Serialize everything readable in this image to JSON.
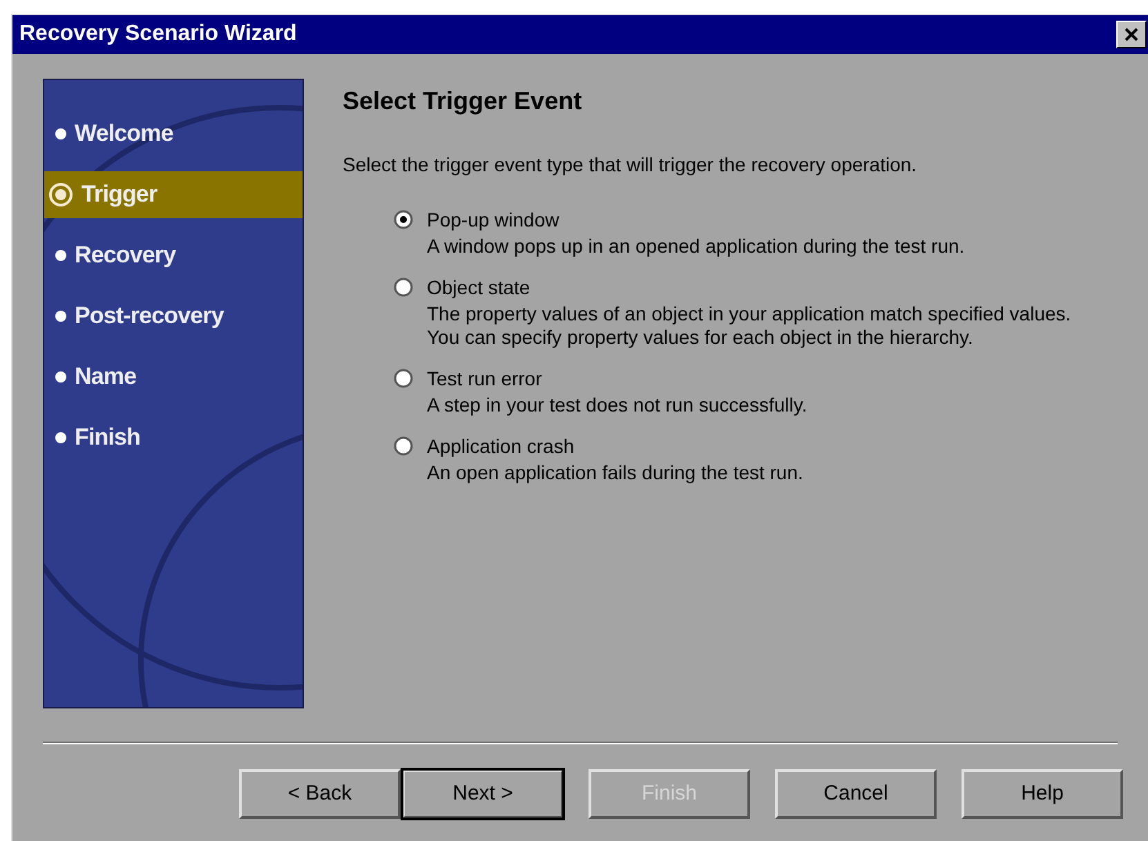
{
  "window": {
    "title": "Recovery Scenario Wizard"
  },
  "steps": [
    {
      "label": "Welcome",
      "selected": false
    },
    {
      "label": "Trigger",
      "selected": true
    },
    {
      "label": "Recovery",
      "selected": false
    },
    {
      "label": "Post-recovery",
      "selected": false
    },
    {
      "label": "Name",
      "selected": false
    },
    {
      "label": "Finish",
      "selected": false
    }
  ],
  "heading": "Select Trigger Event",
  "instruction": "Select the trigger event type that will trigger the recovery operation.",
  "options": [
    {
      "label": "Pop-up window",
      "description": "A window pops up in an opened application during the test run.",
      "selected": true
    },
    {
      "label": "Object state",
      "description": "The property values of an object in your application match specified values. You can specify property values for each object in the hierarchy.",
      "selected": false
    },
    {
      "label": "Test run error",
      "description": "A step in your test does not run successfully.",
      "selected": false
    },
    {
      "label": "Application crash",
      "description": "An open application fails during the test run.",
      "selected": false
    }
  ],
  "buttons": [
    {
      "label": "< Back",
      "disabled": false,
      "default": false
    },
    {
      "label": "Next >",
      "disabled": false,
      "default": true
    },
    {
      "label": "Finish",
      "disabled": true,
      "default": false
    },
    {
      "label": "Cancel",
      "disabled": false,
      "default": false
    },
    {
      "label": "Help",
      "disabled": false,
      "default": false
    }
  ]
}
